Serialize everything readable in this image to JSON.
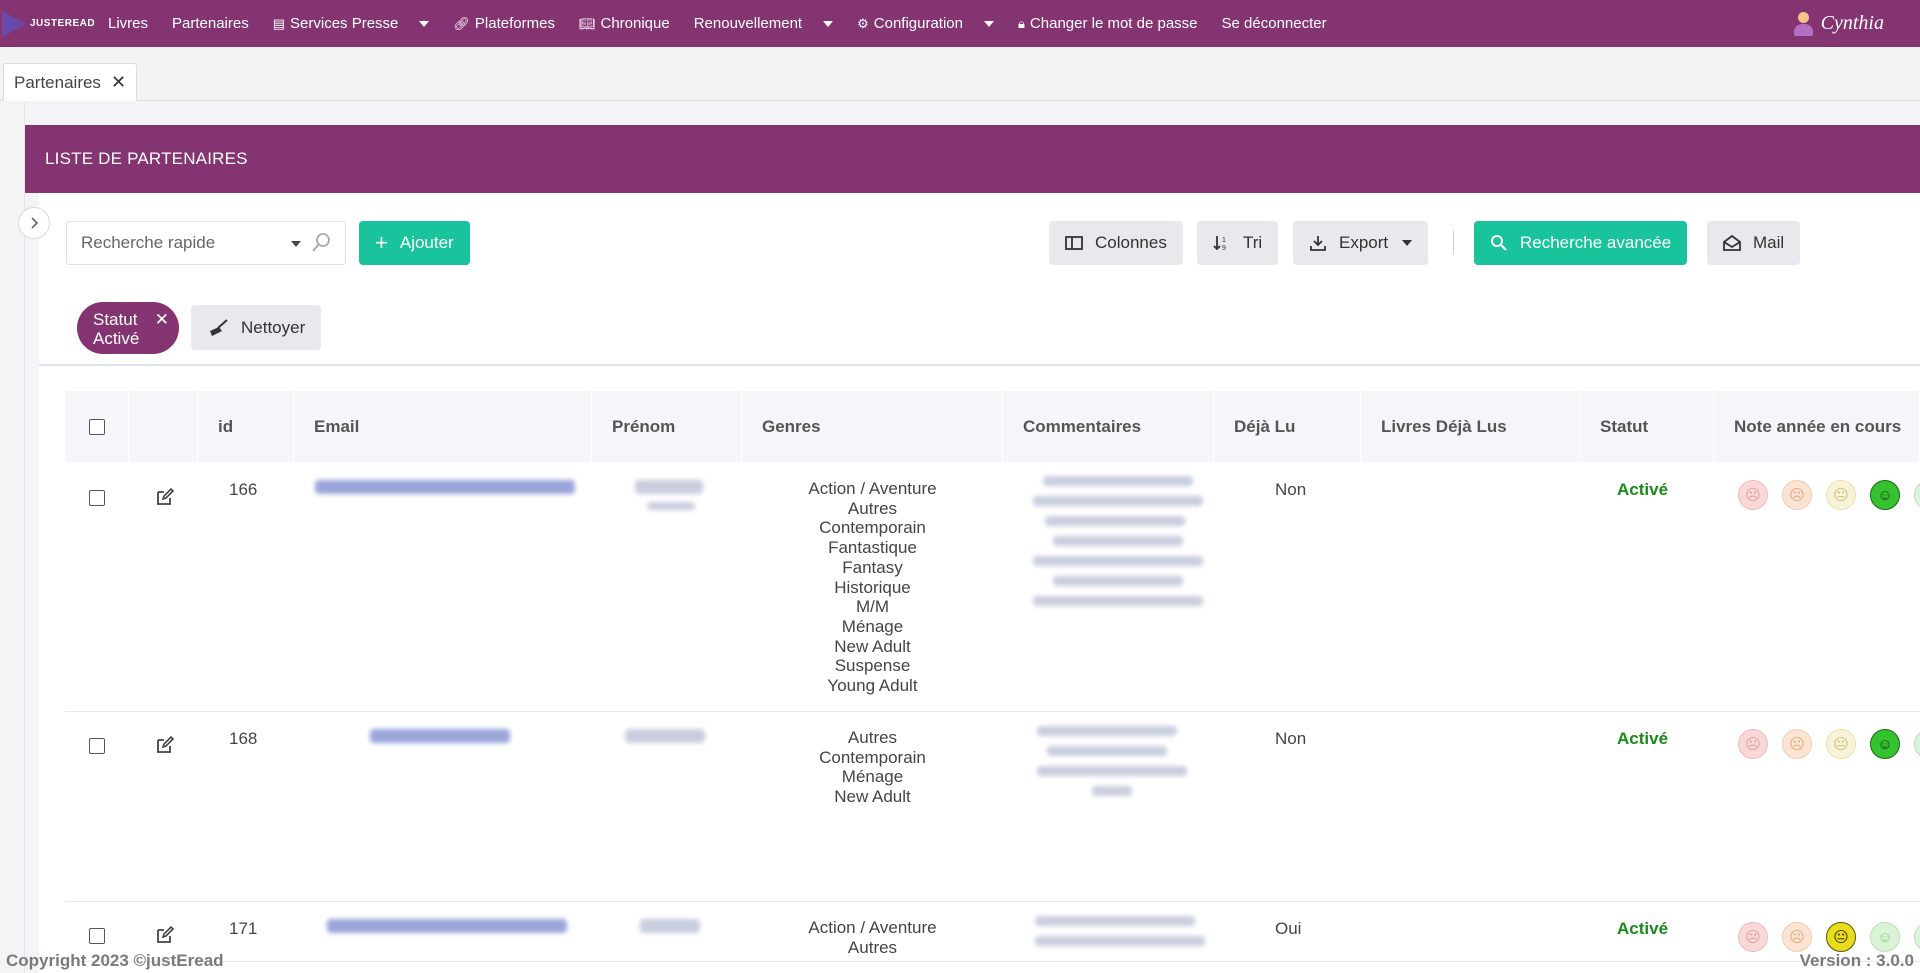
{
  "nav": {
    "logo_text": "JUSTEREAD",
    "items": [
      {
        "label": "Livres",
        "icon": "",
        "dropdown": false
      },
      {
        "label": "Partenaires",
        "icon": "",
        "dropdown": false
      },
      {
        "label": "Services Presse",
        "icon": "newspaper-icon",
        "dropdown": true
      },
      {
        "label": "Plateformes",
        "icon": "link-icon",
        "dropdown": false
      },
      {
        "label": "Chronique",
        "icon": "book-icon",
        "dropdown": false
      },
      {
        "label": "Renouvellement",
        "icon": "",
        "dropdown": true
      },
      {
        "label": "Configuration",
        "icon": "gear-icon",
        "dropdown": true
      },
      {
        "label": "Changer le mot de passe",
        "icon": "lock-icon",
        "dropdown": false
      },
      {
        "label": "Se déconnecter",
        "icon": "",
        "dropdown": false
      }
    ],
    "user_name": "Cynthia"
  },
  "tabs": [
    {
      "label": "Partenaires",
      "close": "✕"
    }
  ],
  "panel": {
    "title": "LISTE DE PARTENAIRES"
  },
  "toolbar": {
    "search_placeholder": "Recherche rapide",
    "add_label": "Ajouter",
    "columns_label": "Colonnes",
    "sort_label": "Tri",
    "export_label": "Export",
    "advanced_search_label": "Recherche avancée",
    "mail_label": "Mail"
  },
  "filters": {
    "chip_line1": "Statut",
    "chip_line2": "Activé",
    "chip_close": "✕",
    "clean_label": "Nettoyer"
  },
  "table": {
    "columns": [
      "id",
      "Email",
      "Prénom",
      "Genres",
      "Commentaires",
      "Déjà Lu",
      "Livres Déjà Lus",
      "Statut",
      "Note année en cours"
    ],
    "rows": [
      {
        "id": "166",
        "genres": [
          "Action / Aventure",
          "Autres",
          "Contemporain",
          "Fantastique",
          "Fantasy",
          "Historique",
          "M/M",
          "Ménage",
          "New Adult",
          "Suspense",
          "Young Adult"
        ],
        "deja_lu": "Non",
        "statut": "Activé",
        "note_selected": 4
      },
      {
        "id": "168",
        "genres": [
          "Autres",
          "Contemporain",
          "Ménage",
          "New Adult"
        ],
        "deja_lu": "Non",
        "statut": "Activé",
        "note_selected": 4
      },
      {
        "id": "171",
        "genres": [
          "Action / Aventure",
          "Autres"
        ],
        "deja_lu": "Oui",
        "statut": "Activé",
        "note_selected": 3
      }
    ]
  },
  "footer": {
    "copyright": "Copyright 2023 ©justEread",
    "version": "Version : 3.0.0"
  },
  "colors": {
    "brand": "#843471",
    "accent": "#19c39b",
    "status_active": "#1a8a1a"
  }
}
